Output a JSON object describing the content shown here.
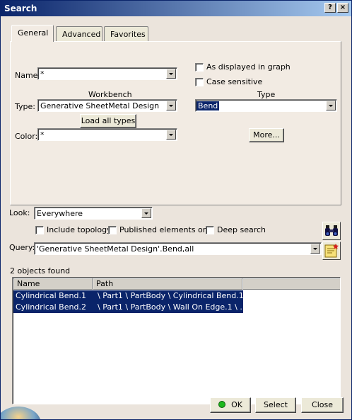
{
  "window": {
    "title": "Search",
    "help_label": "?",
    "close_label": "×"
  },
  "tabs": [
    {
      "label": "General"
    },
    {
      "label": "Advanced"
    },
    {
      "label": "Favorites"
    }
  ],
  "general": {
    "name_label": "Name:",
    "name_value": "*",
    "type_label": "Type:",
    "workbench_header": "Workbench",
    "workbench_value": "Generative SheetMetal Design",
    "load_all_types_label": "Load all types",
    "color_label": "Color:",
    "color_value": "*",
    "as_displayed_label": "As displayed in graph",
    "case_sensitive_label": "Case sensitive",
    "type_header": "Type",
    "type_value": "Bend",
    "more_label": "More..."
  },
  "look": {
    "label": "Look:",
    "value": "Everywhere",
    "include_topology_label": "Include topology",
    "published_only_label": "Published elements only",
    "deep_search_label": "Deep search"
  },
  "query": {
    "label": "Query:",
    "value": "'Generative SheetMetal Design'.Bend,all"
  },
  "results": {
    "count_text": "2 objects found",
    "columns": [
      "Name",
      "Path"
    ],
    "rows": [
      {
        "name": "Cylindrical Bend.1",
        "path": "\\ Part1 \\ PartBody \\ Cylindrical Bend.1"
      },
      {
        "name": "Cylindrical Bend.2",
        "path": "\\ Part1 \\ PartBody \\ Wall On Edge.1 \\ ..."
      }
    ]
  },
  "footer": {
    "ok_label": "OK",
    "select_label": "Select",
    "close_label": "Close"
  },
  "colors": {
    "selection": "#0a246a",
    "title_start": "#0a246a",
    "title_end": "#a6caf0",
    "dialog_bg": "#ebe4dc",
    "ok_indicator": "#1db81d"
  }
}
